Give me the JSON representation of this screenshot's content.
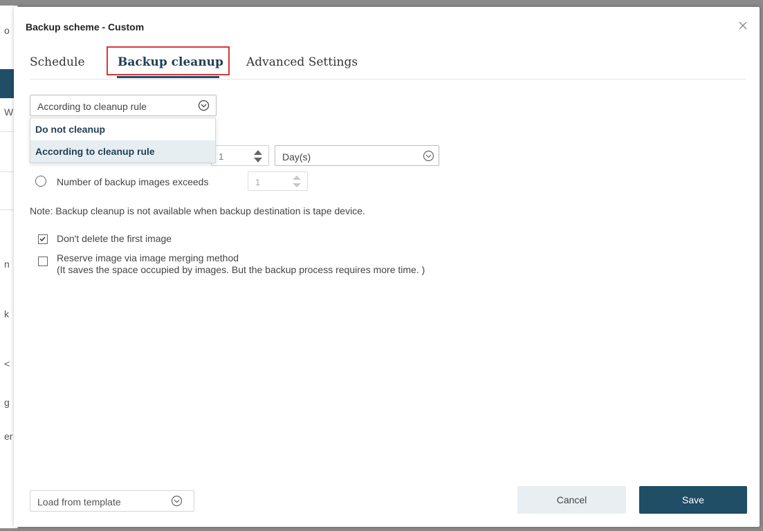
{
  "background_app": {
    "fragments": [
      "o",
      "W",
      "n",
      "k",
      "<",
      "g",
      "er"
    ]
  },
  "modal": {
    "title": "Backup scheme - Custom",
    "close_icon": "close-icon"
  },
  "tabs": [
    {
      "label": "Schedule",
      "active": false
    },
    {
      "label": "Backup cleanup",
      "active": true
    },
    {
      "label": "Advanced Settings",
      "active": false
    }
  ],
  "cleanup_select": {
    "value": "According to cleanup rule",
    "icon": "chevron-down-circle-icon",
    "options": [
      "Do not cleanup",
      "According to cleanup rule"
    ],
    "selected": "According to cleanup rule"
  },
  "rule_age": {
    "value": "1",
    "unit": "Day(s)"
  },
  "rule_count": {
    "label": "Number of backup images exceeds",
    "value": "1"
  },
  "note": "Note: Backup cleanup is not available when backup destination is tape device.",
  "options": {
    "keep_first": {
      "label": "Don't delete the first image",
      "checked": true
    },
    "merge": {
      "label": "Reserve image via image merging method",
      "sublabel": "(It saves the space occupied by images. But the backup process requires more time. )",
      "checked": false
    }
  },
  "footer": {
    "template_select": "Load from template",
    "cancel": "Cancel",
    "save": "Save"
  },
  "colors": {
    "primary": "#1f4e66",
    "highlight": "#d8363a",
    "cancel_bg": "#e8eef1"
  }
}
